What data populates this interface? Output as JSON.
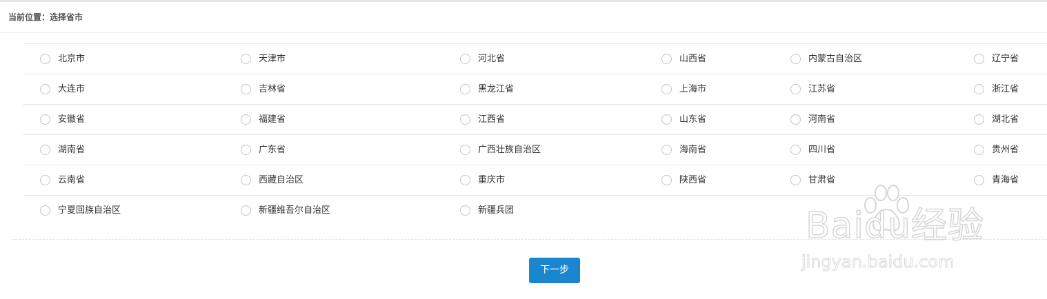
{
  "breadcrumb": {
    "text": "当前位置：选择省市"
  },
  "provinces": {
    "rows": [
      [
        "北京市",
        "天津市",
        "河北省",
        "山西省",
        "内蒙古自治区",
        "辽宁省"
      ],
      [
        "大连市",
        "吉林省",
        "黑龙江省",
        "上海市",
        "江苏省",
        "浙江省"
      ],
      [
        "安徽省",
        "福建省",
        "江西省",
        "山东省",
        "河南省",
        "湖北省"
      ],
      [
        "湖南省",
        "广东省",
        "广西壮族自治区",
        "海南省",
        "四川省",
        "贵州省"
      ],
      [
        "云南省",
        "西藏自治区",
        "重庆市",
        "陕西省",
        "甘肃省",
        "青海省"
      ],
      [
        "宁夏回族自治区",
        "新疆维吾尔自治区",
        "新疆兵团"
      ]
    ],
    "selected": null
  },
  "actions": {
    "next_label": "下一步"
  },
  "watermark": {
    "brand": "Baidu经验",
    "url": "jingyan.baidu.com"
  },
  "colors": {
    "accent": "#1b86d0",
    "divider": "#e6e6e6",
    "text": "#333333"
  }
}
